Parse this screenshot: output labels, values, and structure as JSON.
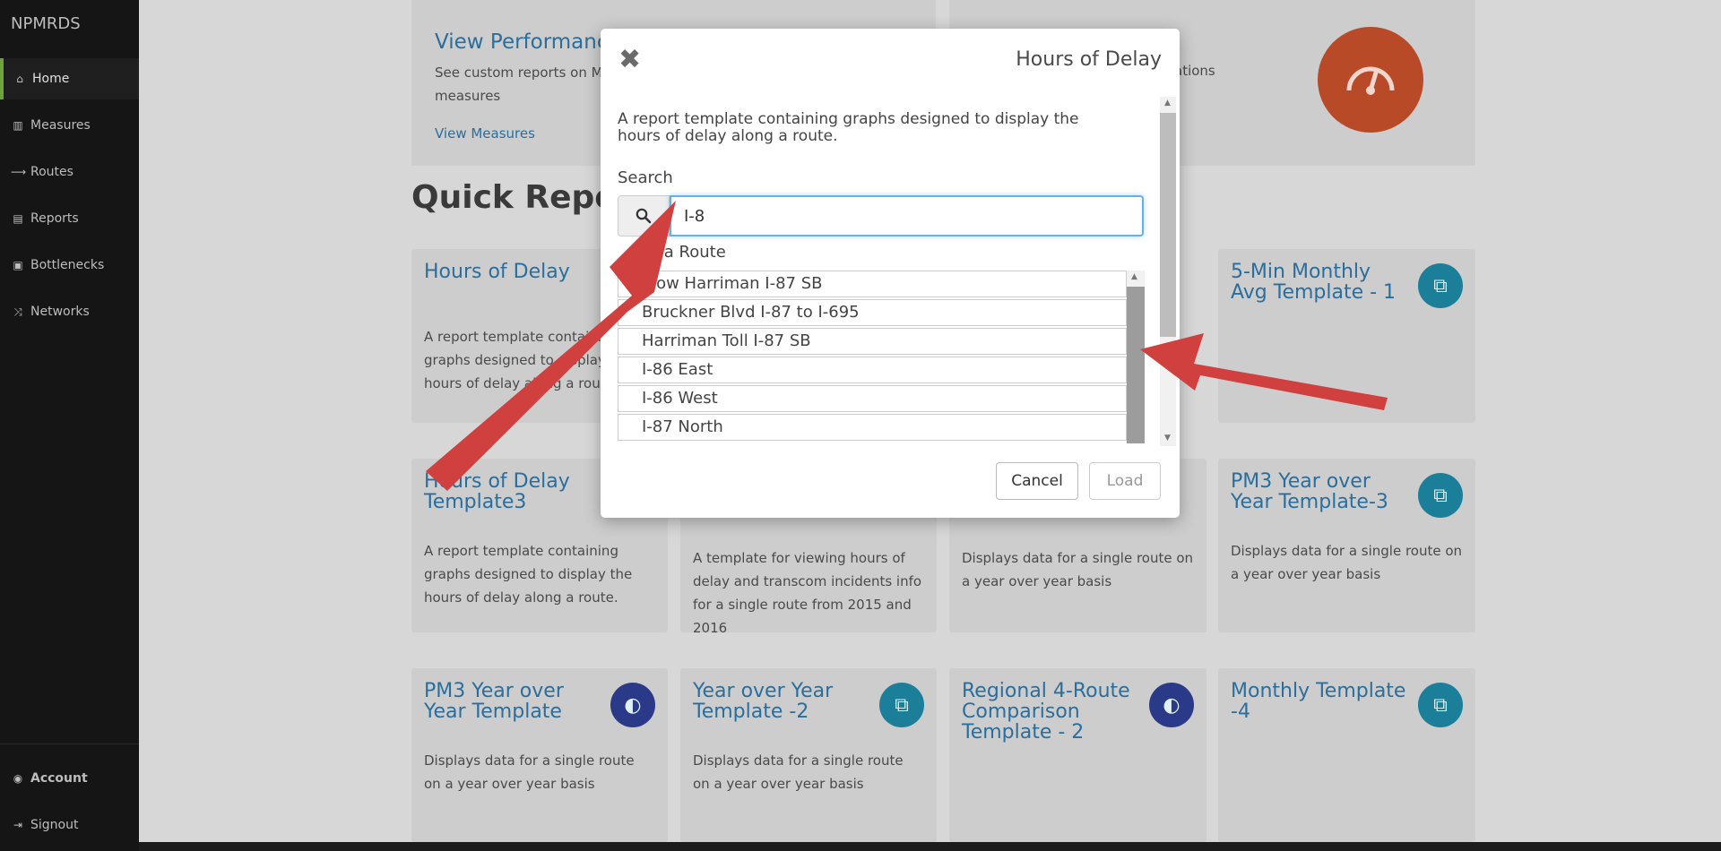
{
  "app": {
    "brand": "NPMRDS"
  },
  "sidebar": {
    "items": [
      {
        "label": "Home",
        "icon": "home-icon",
        "glyph": "⌂"
      },
      {
        "label": "Measures",
        "icon": "bar-chart-icon",
        "glyph": "▥"
      },
      {
        "label": "Routes",
        "icon": "long-arrow-right-icon",
        "glyph": "⟶"
      },
      {
        "label": "Reports",
        "icon": "file-text-icon",
        "glyph": "▤"
      },
      {
        "label": "Bottlenecks",
        "icon": "cubes-icon",
        "glyph": "▣"
      },
      {
        "label": "Networks",
        "icon": "random-icon",
        "glyph": "⤨"
      }
    ],
    "bottom": [
      {
        "label": "Account",
        "icon": "user-circle-icon",
        "glyph": "◉"
      },
      {
        "label": "Signout",
        "icon": "sign-out-icon",
        "glyph": "⇥"
      }
    ]
  },
  "main": {
    "performance": {
      "title": "View Performance",
      "desc_line1": "See custom reports on Ma",
      "desc_line2": "measures",
      "link": "View Measures",
      "right_tail": "ations"
    },
    "quick_reports_title": "Quick Report",
    "cards": [
      {
        "title": "Hours of Delay",
        "desc": "A report template containing graphs designed to display the hours of delay along a route.",
        "icon": "report-icon"
      },
      {
        "title": "5-Min Monthly Avg Template - 1",
        "desc": "",
        "icon": "code-file-icon"
      },
      {
        "title": "Hours of Delay Template3",
        "desc": "A report template containing graphs designed to display the hours of delay along a route.",
        "icon": "palette-icon"
      },
      {
        "title": "",
        "desc": "A template for viewing hours of delay and transcom incidents info for a single route from 2015 and 2016",
        "icon": "code-file-icon"
      },
      {
        "title": "",
        "desc": "Displays data for a single route on a year over year basis",
        "icon": "palette-icon"
      },
      {
        "title": "PM3 Year over Year Template-3",
        "desc": "Displays data for a single route on a year over year basis",
        "icon": "code-file-icon"
      },
      {
        "title": "PM3 Year over Year Template",
        "desc": "Displays data for a single route on a year over year basis",
        "icon": "palette-icon"
      },
      {
        "title": "Year over Year Template -2",
        "desc": "Displays data for a single route on a year over year basis",
        "icon": "code-file-icon"
      },
      {
        "title": "Regional 4-Route Comparison Template - 2",
        "desc": "",
        "icon": "palette-icon"
      },
      {
        "title": "Monthly Template -4",
        "desc": "",
        "icon": "code-file-icon"
      }
    ]
  },
  "modal": {
    "title": "Hours of Delay",
    "close_icon": "close-icon",
    "description": "A report template containing graphs designed to display the hours of delay along a route.",
    "search_label": "Search",
    "search_value": "I-8",
    "route_label": "t a Route",
    "routes": [
      "elow Harriman I-87 SB",
      "Bruckner Blvd I-87 to I-695",
      "Harriman Toll I-87 SB",
      "I-86 East",
      "I-86 West",
      "I-87 North"
    ],
    "cancel_label": "Cancel",
    "load_label": "Load"
  },
  "colors": {
    "accent": "#2a6e9d",
    "sidebar_bg": "#151515",
    "active_bar": "#6da33a",
    "annotation_arrow": "#d0403f",
    "speedometer": "#b84a28"
  }
}
